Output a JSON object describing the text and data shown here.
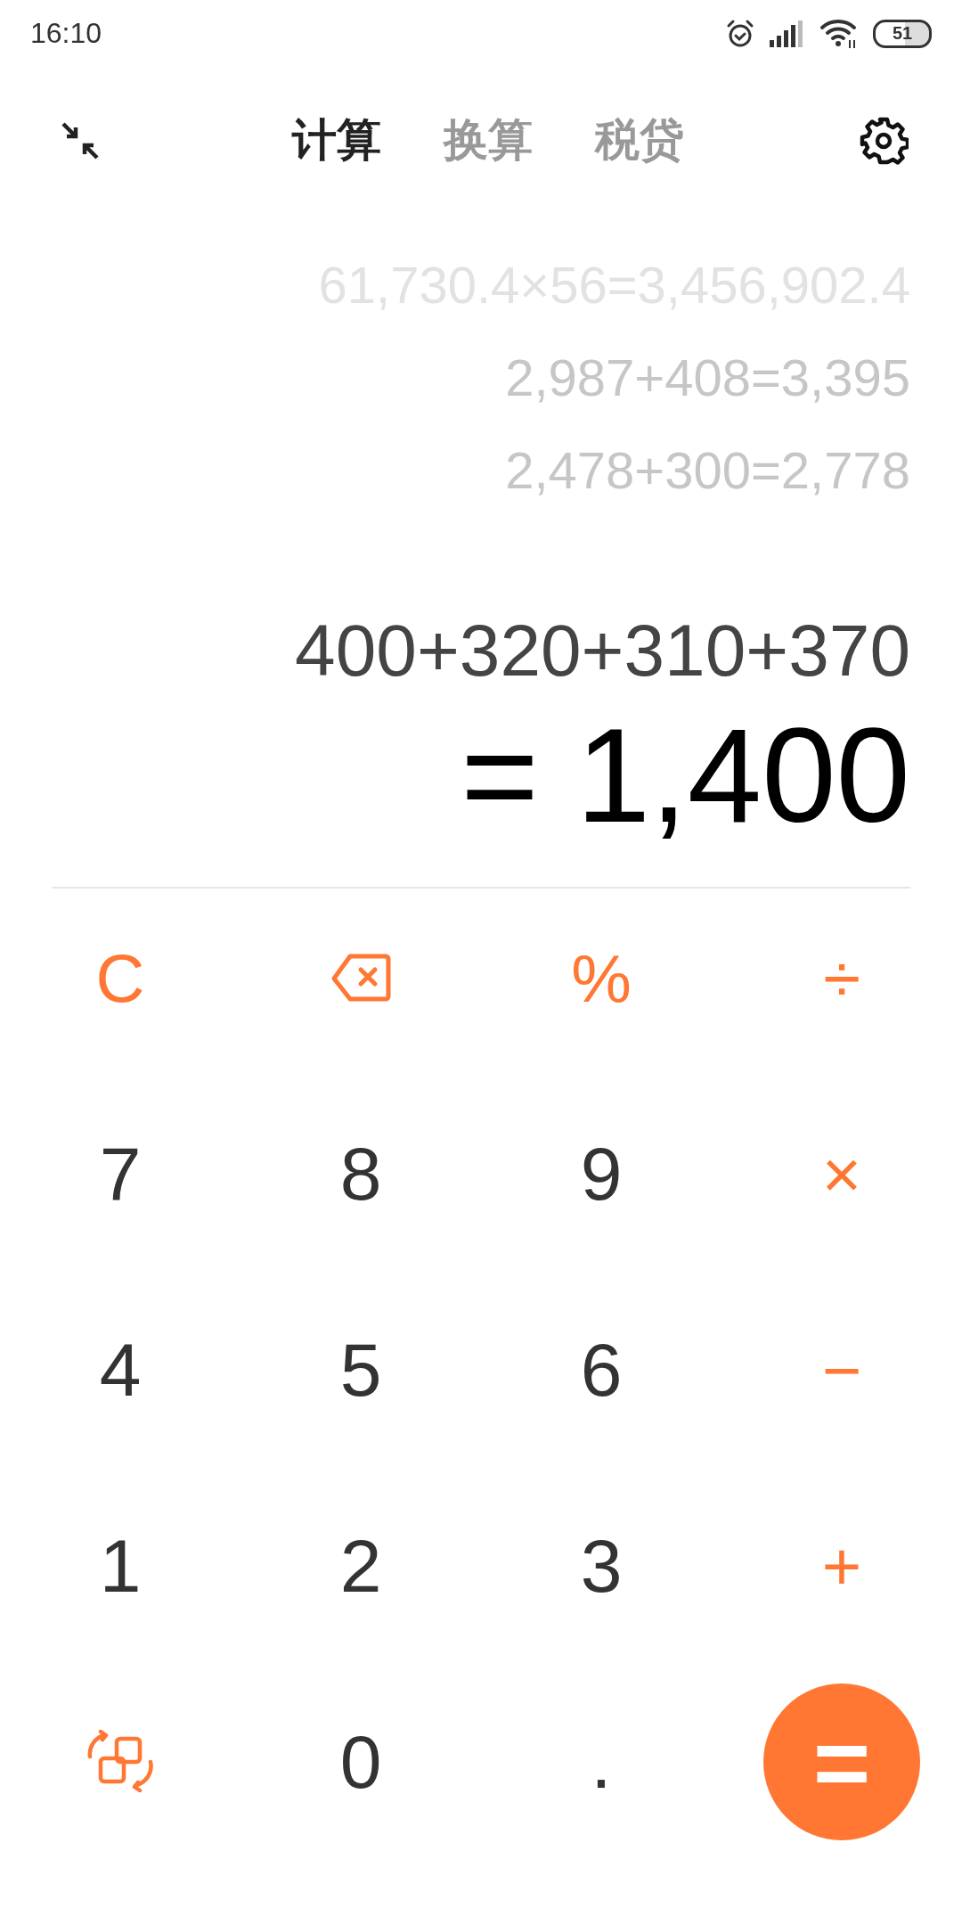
{
  "status_bar": {
    "time": "16:10",
    "battery": "51"
  },
  "tabs": [
    {
      "label": "计算",
      "selected": true
    },
    {
      "label": "换算",
      "selected": false
    },
    {
      "label": "税贷",
      "selected": false
    }
  ],
  "history": [
    "61,730.4×56=3,456,902.4",
    "2,987+408=3,395",
    "2,478+300=2,778"
  ],
  "expression": "400+320+310+370",
  "result": "= 1,400",
  "keys": [
    {
      "kind": "operator",
      "label": "C"
    },
    {
      "kind": "backspace"
    },
    {
      "kind": "operator",
      "label": "%"
    },
    {
      "kind": "operator",
      "label": "÷"
    },
    {
      "kind": "digit",
      "label": "7"
    },
    {
      "kind": "digit",
      "label": "8"
    },
    {
      "kind": "digit",
      "label": "9"
    },
    {
      "kind": "operator",
      "label": "×"
    },
    {
      "kind": "digit",
      "label": "4"
    },
    {
      "kind": "digit",
      "label": "5"
    },
    {
      "kind": "digit",
      "label": "6"
    },
    {
      "kind": "operator",
      "label": "−"
    },
    {
      "kind": "digit",
      "label": "1"
    },
    {
      "kind": "digit",
      "label": "2"
    },
    {
      "kind": "digit",
      "label": "3"
    },
    {
      "kind": "operator",
      "label": "+"
    },
    {
      "kind": "switch"
    },
    {
      "kind": "digit",
      "label": "0"
    },
    {
      "kind": "digit",
      "label": "."
    },
    {
      "kind": "equals",
      "label": "="
    }
  ]
}
